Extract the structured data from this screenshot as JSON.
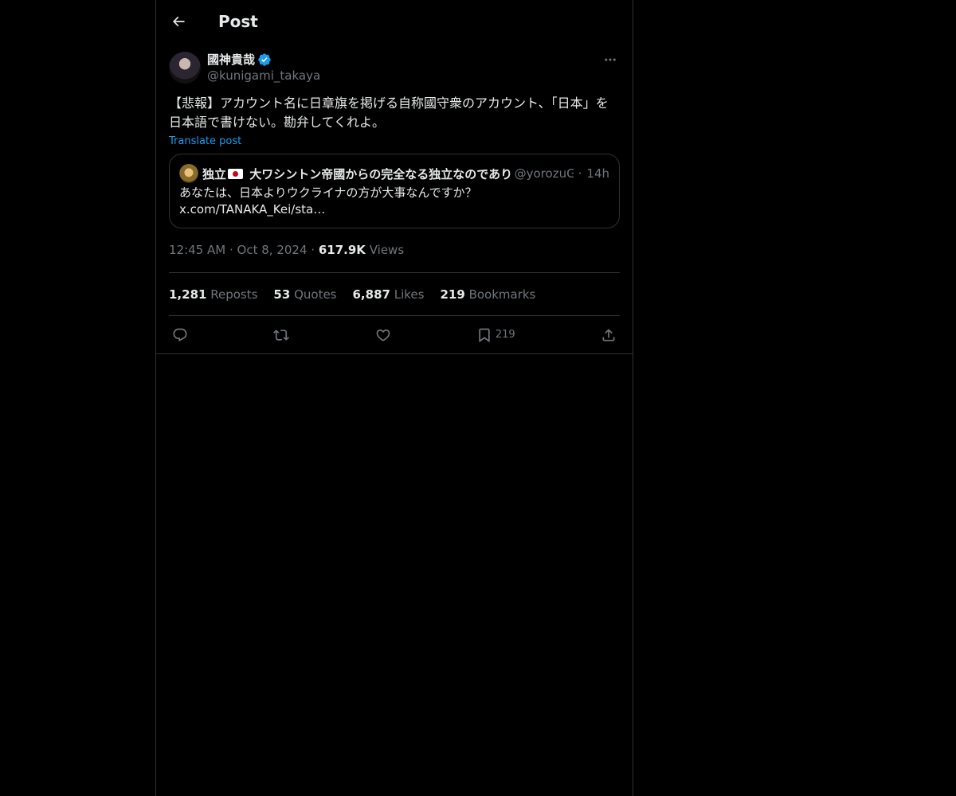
{
  "header": {
    "title": "Post"
  },
  "post": {
    "author": {
      "display_name": "國神貴哉",
      "handle": "@kunigami_takaya",
      "verified": true
    },
    "text": "【悲報】アカウント名に日章旗を掲げる自称國守衆のアカウント、「日本」を日本語で書けない。勘弁してくれよ。",
    "translate_label": "Translate post",
    "quote": {
      "name_part1": "独立",
      "name_part2": " 大ワシントン帝國からの完全なる独立なのであります",
      "handle": "@yorozuGa",
      "separator": "·",
      "time": "14h",
      "text": "あなたは、日本よりウクライナの方が大事なんですか？\nx.com/TANAKA_Kei/sta…"
    },
    "meta": {
      "time": "12:45 AM",
      "date": "Oct 8, 2024",
      "separator": "·",
      "views_count": "617.9K",
      "views_label": "Views"
    },
    "stats": [
      {
        "count": "1,281",
        "label": "Reposts"
      },
      {
        "count": "53",
        "label": "Quotes"
      },
      {
        "count": "6,887",
        "label": "Likes"
      },
      {
        "count": "219",
        "label": "Bookmarks"
      }
    ],
    "actions": {
      "reply_icon": "reply-icon",
      "repost_icon": "repost-icon",
      "like_icon": "heart-icon",
      "bookmark_icon": "bookmark-icon",
      "bookmark_count": "219",
      "share_icon": "share-icon"
    }
  },
  "colors": {
    "background": "#000000",
    "text": "#e7e9ea",
    "muted": "#71767b",
    "accent": "#1d9bf0",
    "border": "#2f3336"
  }
}
